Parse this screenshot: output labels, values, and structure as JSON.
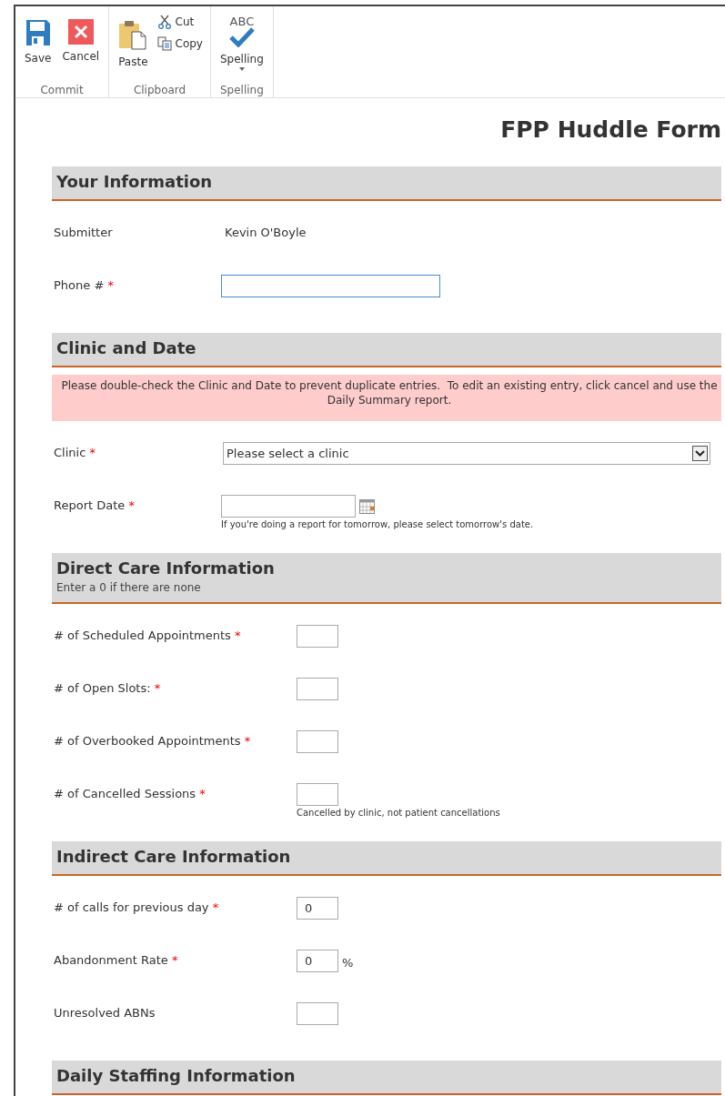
{
  "ribbon": {
    "groups": [
      {
        "label": "Commit",
        "buttons": [
          {
            "label": "Save",
            "dropdown": false
          },
          {
            "label": "Cancel",
            "dropdown": false
          }
        ]
      },
      {
        "label": "Clipboard",
        "buttons": [
          {
            "label": "Paste",
            "dropdown": false
          }
        ],
        "small_buttons": [
          {
            "label": "Cut"
          },
          {
            "label": "Copy"
          }
        ]
      },
      {
        "label": "Spelling",
        "buttons": [
          {
            "label": "Spelling",
            "icon_text": "ABC",
            "dropdown": true
          }
        ]
      }
    ]
  },
  "form": {
    "title": "FPP Huddle Form",
    "sections": [
      {
        "title": "Your Information",
        "fields": [
          {
            "kind": "static",
            "label": "Submitter",
            "value": "Kevin O'Boyle"
          },
          {
            "kind": "text",
            "label": "Phone #",
            "marker": "*",
            "focused": true
          }
        ]
      },
      {
        "title": "Clinic and Date",
        "notice": "Please double-check the Clinic and Date to prevent duplicate entries.  To edit an existing entry, click cancel and use the Daily Summary report.",
        "fields": [
          {
            "kind": "select",
            "label": "Clinic",
            "value": "Please select a clinic",
            "marker": "*",
            "focused": false
          },
          {
            "kind": "date",
            "label": "Report Date",
            "marker": "*",
            "focused": false,
            "hint": "If you're doing a report for tomorrow, please select tomorrow's date."
          }
        ]
      },
      {
        "title": "Direct Care Information",
        "subtitle": "Enter a 0 if there are none",
        "fields": [
          {
            "kind": "number",
            "label": "# of Scheduled Appointments",
            "marker": "*",
            "focused": false
          },
          {
            "kind": "number",
            "label": "# of Open Slots:",
            "marker": "*",
            "focused": false
          },
          {
            "kind": "number",
            "label": "# of Overbooked Appointments",
            "marker": "*",
            "focused": false
          },
          {
            "kind": "number",
            "label": "# of Cancelled Sessions",
            "marker": "*",
            "focused": false,
            "hint": "Cancelled by clinic, not patient cancellations"
          }
        ]
      },
      {
        "title": "Indirect Care Information",
        "fields": [
          {
            "kind": "number",
            "label": "# of calls for previous day",
            "marker": "*",
            "focused": false,
            "value": "0"
          },
          {
            "kind": "number",
            "label": "Abandonment Rate",
            "marker": "*",
            "focused": false,
            "value": "0",
            "suffix": "%"
          },
          {
            "kind": "number",
            "label": "Unresolved ABNs",
            "focused": false
          }
        ]
      },
      {
        "title": "Daily Staffing Information"
      }
    ]
  }
}
